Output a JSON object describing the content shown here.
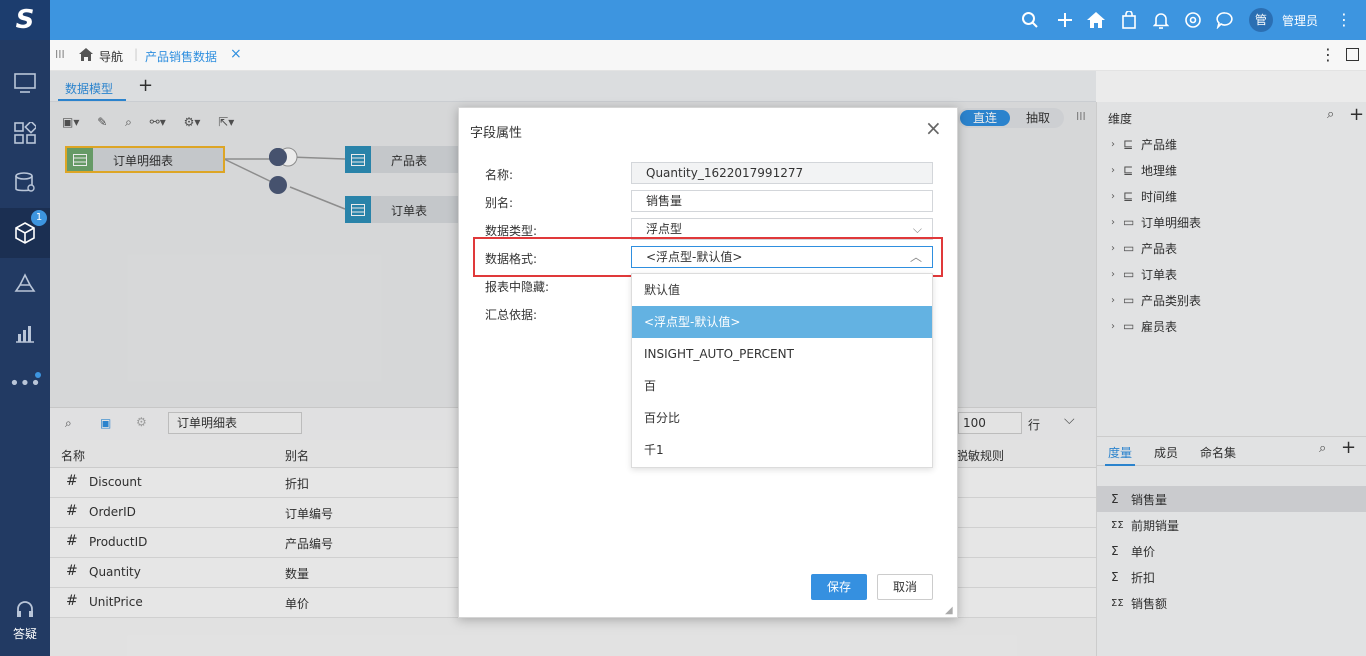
{
  "app": {
    "logo_letter": "S",
    "user_avatar": "管",
    "user_name": "管理员",
    "left_nav": {
      "badge": "1",
      "help_label": "答疑"
    }
  },
  "tabs": {
    "nav_label": "导航",
    "active_tab": "产品销售数据",
    "close_symbol": "×"
  },
  "model_bar": {
    "tab_label": "数据模型",
    "add_symbol": "+",
    "mode_direct": "直连",
    "mode_extract": "抽取"
  },
  "canvas": {
    "main_table": "订单明细表",
    "table1": "产品表",
    "table2": "订单表"
  },
  "field_toolbar": {
    "table_name": "订单明细表",
    "page_size": "100",
    "row_unit": "行"
  },
  "field_table": {
    "headers": {
      "name": "名称",
      "alias": "别名",
      "mask": "脱敏规则"
    },
    "rows": [
      {
        "type": "#",
        "name": "Discount",
        "alias": "折扣"
      },
      {
        "type": "#",
        "name": "OrderID",
        "alias": "订单编号"
      },
      {
        "type": "#",
        "name": "ProductID",
        "alias": "产品编号"
      },
      {
        "type": "#",
        "name": "Quantity",
        "alias": "数量"
      },
      {
        "type": "#",
        "name": "UnitPrice",
        "alias": "单价"
      }
    ]
  },
  "right_panel": {
    "dimension_title": "维度",
    "dimensions": [
      {
        "label": "产品维",
        "icon": "hierarchy-icon"
      },
      {
        "label": "地理维",
        "icon": "hierarchy-icon"
      },
      {
        "label": "时间维",
        "icon": "hierarchy-icon"
      },
      {
        "label": "订单明细表",
        "icon": "table-folder-icon"
      },
      {
        "label": "产品表",
        "icon": "table-folder-icon"
      },
      {
        "label": "订单表",
        "icon": "table-folder-icon"
      },
      {
        "label": "产品类别表",
        "icon": "table-folder-icon"
      },
      {
        "label": "雇员表",
        "icon": "folder-icon"
      }
    ],
    "measure_tabs": [
      "度量",
      "成员",
      "命名集"
    ],
    "measures": [
      {
        "label": "销售量",
        "icon": "Σ"
      },
      {
        "label": "前期销量",
        "icon": "ΣΣ"
      },
      {
        "label": "单价",
        "icon": "Σ"
      },
      {
        "label": "折扣",
        "icon": "Σ"
      },
      {
        "label": "销售额",
        "icon": "ΣΣ"
      }
    ]
  },
  "dialog": {
    "title": "字段属性",
    "close_symbol": "×",
    "name_label": "名称:",
    "name_value": "Quantity_1622017991277",
    "alias_label": "别名:",
    "alias_value": "销售量",
    "type_label": "数据类型:",
    "type_value": "浮点型",
    "format_label": "数据格式:",
    "format_value": "<浮点型-默认值>",
    "hidden_label": "报表中隐藏:",
    "aggregate_label": "汇总依据:",
    "format_options": [
      "默认值",
      "<浮点型-默认值>",
      "INSIGHT_AUTO_PERCENT",
      "百",
      "百分比",
      "千1"
    ],
    "selected_option_index": 1,
    "save_label": "保存",
    "cancel_label": "取消"
  },
  "colors": {
    "topbar": "#3d95e0",
    "sidebar": "#223a63",
    "accent": "#2f8fdf",
    "selected_option": "#63b2e2",
    "highlight_border": "#e0393a",
    "save_button": "#3590e0"
  }
}
